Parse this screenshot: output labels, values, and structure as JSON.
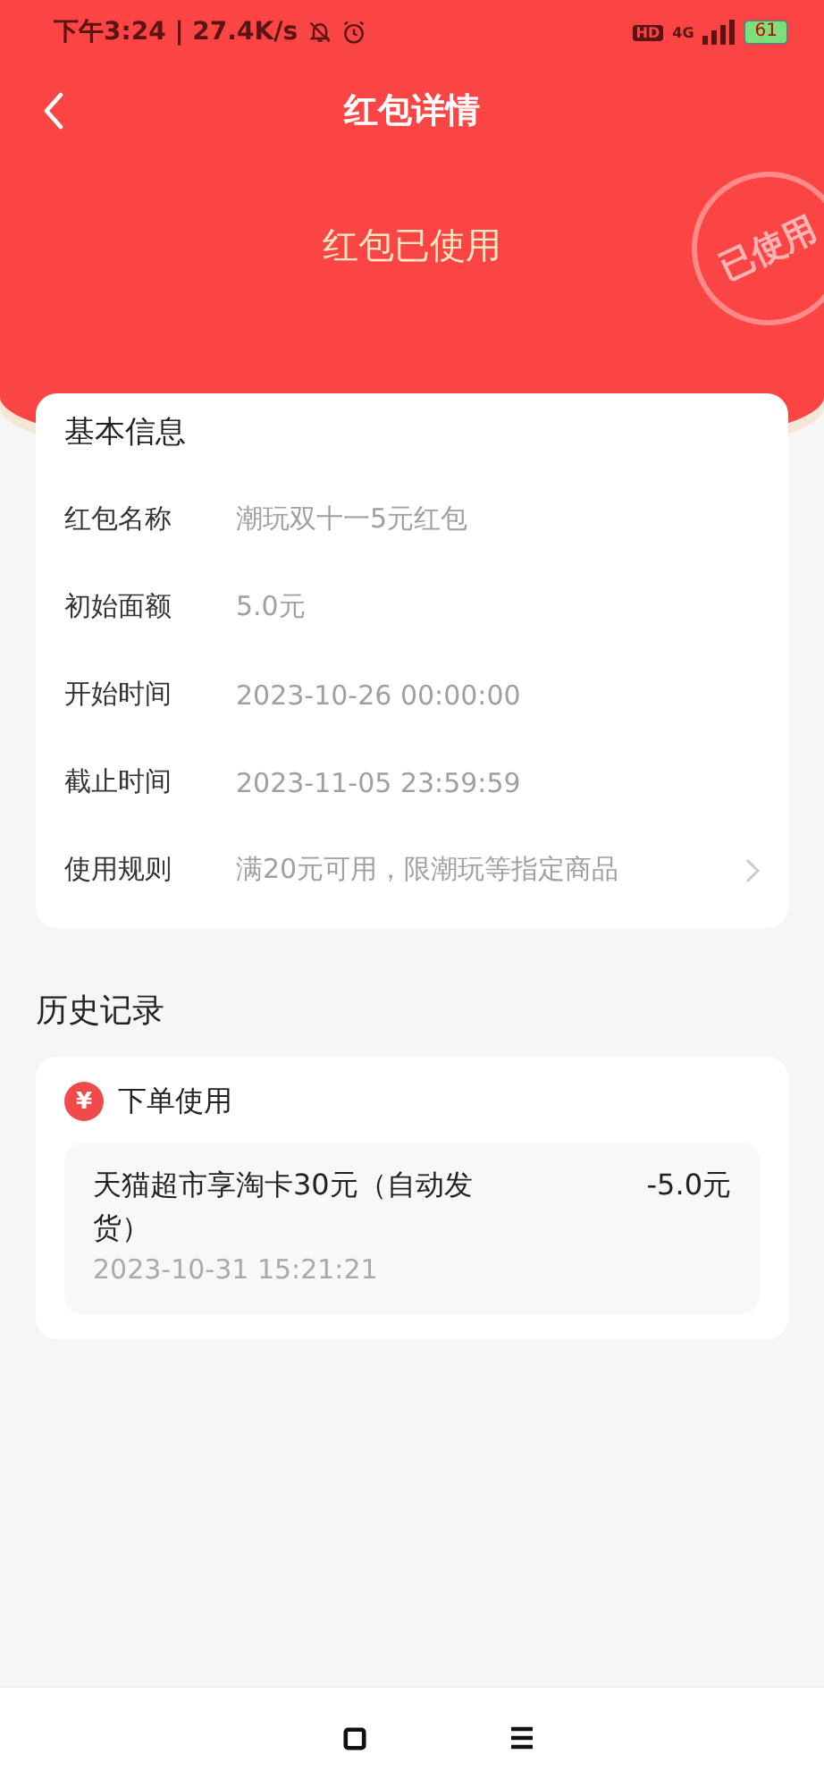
{
  "status_bar": {
    "time": "下午3:24 | 27.4K/s",
    "hd": "HD",
    "network": "4G",
    "battery": "61"
  },
  "header": {
    "title": "红包详情"
  },
  "status": {
    "text": "红包已使用",
    "stamp": "已使用"
  },
  "basic_info": {
    "title": "基本信息",
    "rows": [
      {
        "label": "红包名称",
        "value": "潮玩双十一5元红包",
        "has_arrow": false
      },
      {
        "label": "初始面额",
        "value": "5.0元",
        "has_arrow": false
      },
      {
        "label": "开始时间",
        "value": "2023-10-26 00:00:00",
        "has_arrow": false
      },
      {
        "label": "截止时间",
        "value": "2023-11-05 23:59:59",
        "has_arrow": false
      },
      {
        "label": "使用规则",
        "value": "满20元可用，限潮玩等指定商品",
        "has_arrow": true
      }
    ]
  },
  "history": {
    "title": "历史记录",
    "records": [
      {
        "icon": "¥",
        "type": "下单使用",
        "item": "天猫超市享淘卡30元（自动发货）",
        "amount": "-5.0元",
        "time": "2023-10-31 15:21:21"
      }
    ]
  }
}
